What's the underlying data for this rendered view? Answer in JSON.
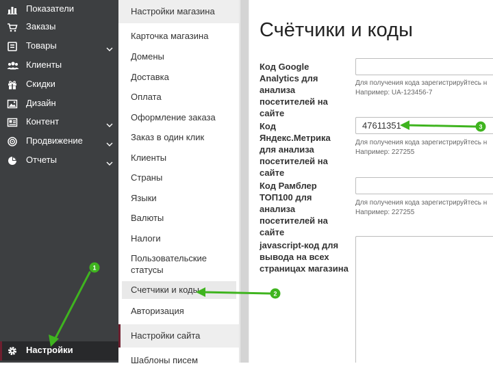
{
  "sidebar": {
    "items": [
      {
        "label": "Показатели",
        "icon": "bar-chart-icon"
      },
      {
        "label": "Заказы",
        "icon": "cart-icon"
      },
      {
        "label": "Товары",
        "icon": "products-icon",
        "has_children": true
      },
      {
        "label": "Клиенты",
        "icon": "users-icon"
      },
      {
        "label": "Скидки",
        "icon": "gift-icon"
      },
      {
        "label": "Дизайн",
        "icon": "image-icon"
      },
      {
        "label": "Контент",
        "icon": "content-icon",
        "has_children": true
      },
      {
        "label": "Продвижение",
        "icon": "target-icon",
        "has_children": true
      },
      {
        "label": "Отчеты",
        "icon": "pie-chart-icon",
        "has_children": true
      }
    ],
    "settings": {
      "label": "Настройки",
      "icon": "gear-icon",
      "active": true
    }
  },
  "submenu": {
    "header": "Настройки магазина",
    "items": [
      "Карточка магазина",
      "Домены",
      "Доставка",
      "Оплата",
      "Оформление заказа",
      "Заказ в один клик",
      "Клиенты",
      "Страны",
      "Языки",
      "Валюты",
      "Налоги",
      "Пользовательские статусы",
      "Счетчики и коды",
      "Авторизация"
    ],
    "active_item": "Счетчики и коды",
    "header2": "Настройки сайта",
    "item_after_header2": "Шаблоны писем"
  },
  "main": {
    "title": "Счётчики и коды",
    "fields": [
      {
        "label": "Код Google Analytics для анализа посетителей на сайте",
        "value": "",
        "hint": "Для получения кода зарегистрируйтесь н",
        "example": "Например: UA-123456-7"
      },
      {
        "label": "Код Яндекс.Метрика для анализа посетителей на сайте",
        "value": "47611351",
        "hint": "Для получения кода зарегистрируйтесь н",
        "example": "Например: 227255"
      },
      {
        "label": "Код Рамблер ТОП100 для анализа посетителей на сайте",
        "value": "",
        "hint": "Для получения кода зарегистрируйтесь н",
        "example": "Например: 227255"
      },
      {
        "label": "javascript-код для вывода на всех страницах магазина",
        "value": ""
      }
    ]
  },
  "annotations": {
    "badges": [
      "1",
      "2",
      "3"
    ],
    "color": "#3fb41f"
  },
  "colors": {
    "sidebar_bg": "#3d3f41",
    "sidebar_active_bg": "#28292b",
    "accent": "#6e1f2f",
    "submenu_header_bg": "#eeeeee",
    "annotation_green": "#3fb41f"
  }
}
